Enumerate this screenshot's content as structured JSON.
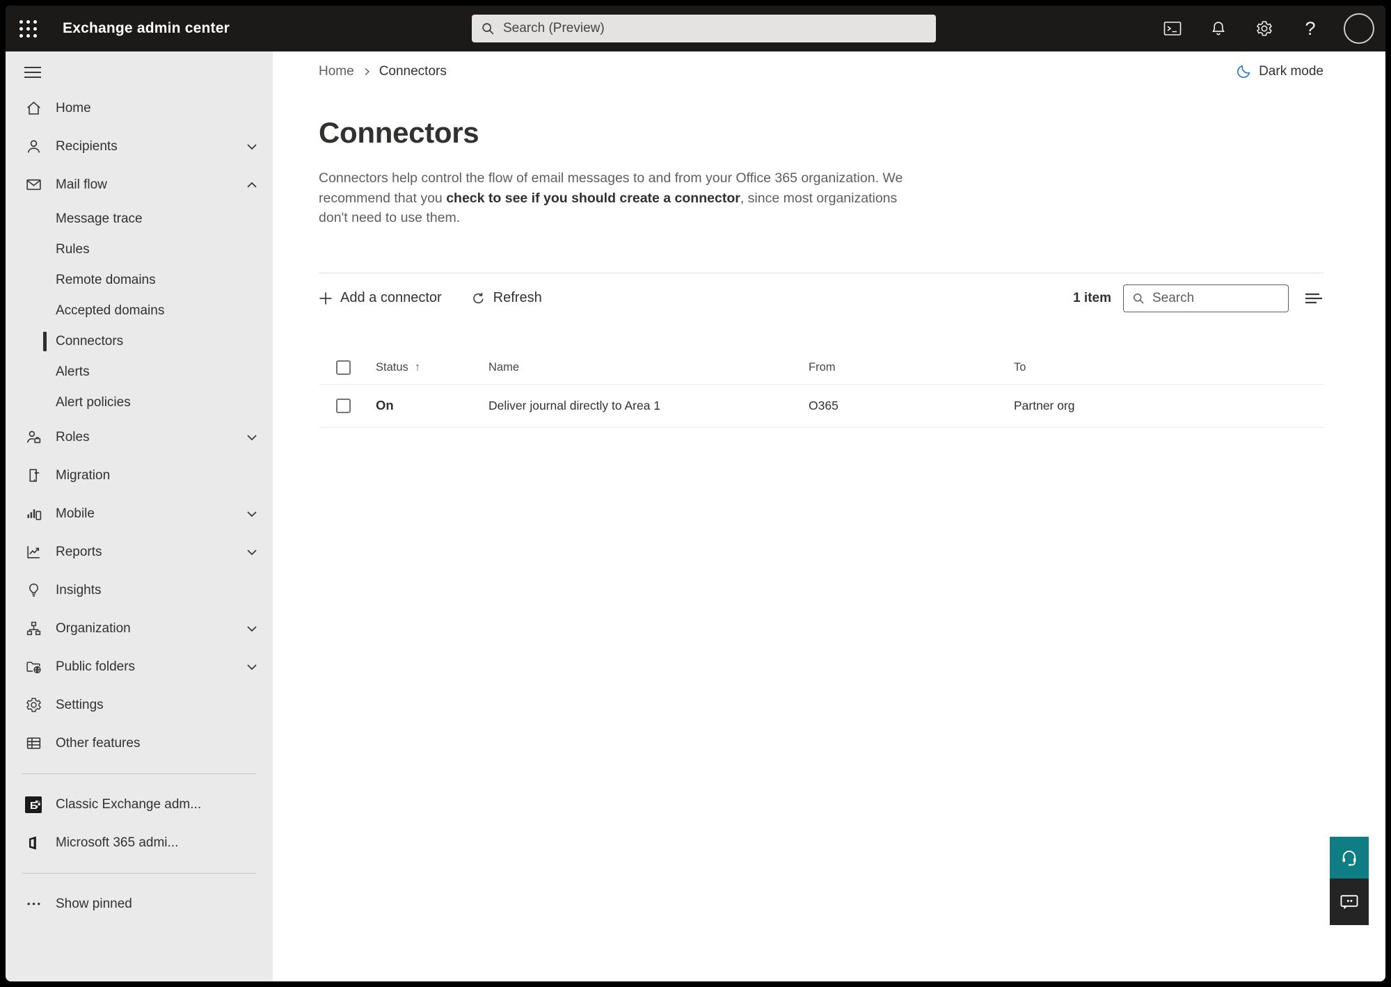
{
  "topbar": {
    "app_title": "Exchange admin center",
    "search_placeholder": "Search (Preview)"
  },
  "breadcrumb": {
    "home": "Home",
    "current": "Connectors"
  },
  "header": {
    "dark_mode_label": "Dark mode"
  },
  "page": {
    "title": "Connectors",
    "description_pre": "Connectors help control the flow of email messages to and from your Office 365 organization. We recommend that you ",
    "description_emphasis": "check to see if you should create a connector",
    "description_post": ", since most organizations don't need to use them."
  },
  "toolbar": {
    "add_connector_label": "Add a connector",
    "refresh_label": "Refresh",
    "item_count": "1 item",
    "search_placeholder": "Search"
  },
  "table": {
    "headers": {
      "status": "Status",
      "name": "Name",
      "from": "From",
      "to": "To"
    },
    "sort_arrow": "↑",
    "rows": [
      {
        "status": "On",
        "name": "Deliver journal directly to Area 1",
        "from": "O365",
        "to": "Partner org"
      }
    ]
  },
  "sidebar": {
    "items": [
      {
        "label": "Home"
      },
      {
        "label": "Recipients"
      },
      {
        "label": "Mail flow"
      },
      {
        "label": "Message trace"
      },
      {
        "label": "Rules"
      },
      {
        "label": "Remote domains"
      },
      {
        "label": "Accepted domains"
      },
      {
        "label": "Connectors"
      },
      {
        "label": "Alerts"
      },
      {
        "label": "Alert policies"
      },
      {
        "label": "Roles"
      },
      {
        "label": "Migration"
      },
      {
        "label": "Mobile"
      },
      {
        "label": "Reports"
      },
      {
        "label": "Insights"
      },
      {
        "label": "Organization"
      },
      {
        "label": "Public folders"
      },
      {
        "label": "Settings"
      },
      {
        "label": "Other features"
      },
      {
        "label": "Classic Exchange adm..."
      },
      {
        "label": "Microsoft 365 admi..."
      },
      {
        "label": "Show pinned"
      }
    ]
  },
  "colors": {
    "topbar_bg": "#1b1a19",
    "sidebar_bg": "#eaeaea",
    "selected_indicator": "#2f2e2d",
    "dark_mode_accent": "#2b7cd3",
    "help_fab_teal": "#0f7d84",
    "feedback_fab_dark": "#242424"
  }
}
